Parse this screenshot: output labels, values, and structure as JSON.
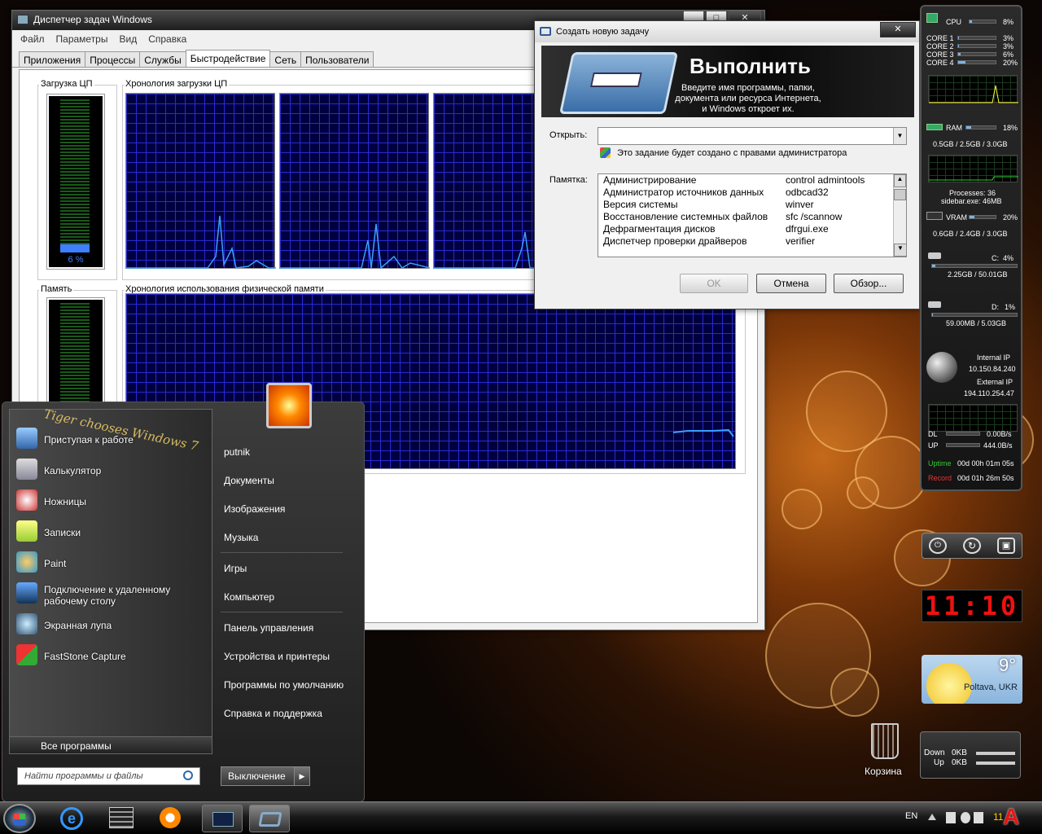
{
  "task_manager": {
    "title": "Диспетчер задач Windows",
    "menu": [
      "Файл",
      "Параметры",
      "Вид",
      "Справка"
    ],
    "tabs": [
      "Приложения",
      "Процессы",
      "Службы",
      "Быстродействие",
      "Сеть",
      "Пользователи"
    ],
    "cpu_usage_label": "Загрузка ЦП",
    "cpu_usage_value": "6 %",
    "cpu_history_label": "Хронология загрузки ЦП",
    "memory_label": "Память",
    "memory_history_label": "Хронология использования физической памяти"
  },
  "run_dialog": {
    "title": "Создать новую задачу",
    "heading": "Выполнить",
    "description": "Введите имя программы, папки, документа или ресурса Интернета, и Windows откроет их.",
    "open_label": "Открыть:",
    "open_value": "",
    "admin_note": "Это задание будет создано с правами администратора",
    "memo_label": "Памятка:",
    "memo_rows": [
      {
        "name": "Администрирование",
        "cmd": "control admintools"
      },
      {
        "name": "Администратор источников данных",
        "cmd": "odbcad32"
      },
      {
        "name": "Версия системы",
        "cmd": "winver"
      },
      {
        "name": "Восстановление системных файлов",
        "cmd": "sfc /scannow"
      },
      {
        "name": "Дефрагментация дисков",
        "cmd": "dfrgui.exe"
      },
      {
        "name": "Диспетчер проверки драйверов",
        "cmd": "verifier"
      }
    ],
    "ok": "OK",
    "cancel": "Отмена",
    "browse": "Обзор..."
  },
  "start_menu": {
    "watermark": "Tiger chooses Windows 7",
    "programs": [
      "Приступая к работе",
      "Калькулятор",
      "Ножницы",
      "Записки",
      "Paint",
      "Подключение к удаленному рабочему столу",
      "Экранная лупа",
      "FastStone Capture"
    ],
    "all_programs": "Все программы",
    "search_placeholder": "Найти программы и файлы",
    "places": [
      "putnik",
      "Документы",
      "Изображения",
      "Музыка",
      "Игры",
      "Компьютер",
      "Панель управления",
      "Устройства и принтеры",
      "Программы по умолчанию",
      "Справка и поддержка"
    ],
    "shutdown": "Выключение"
  },
  "sidebar": {
    "cpu": {
      "label": "CPU",
      "value": "8%",
      "level": 0.08
    },
    "cores": [
      {
        "label": "CORE 1",
        "value": "3%",
        "level": 0.03
      },
      {
        "label": "CORE 2",
        "value": "3%",
        "level": 0.03
      },
      {
        "label": "CORE 3",
        "value": "6%",
        "level": 0.06
      },
      {
        "label": "CORE 4",
        "value": "20%",
        "level": 0.2
      }
    ],
    "ram": {
      "label": "RAM",
      "value": "18%",
      "detail": "0.5GB / 2.5GB / 3.0GB",
      "level": 0.18
    },
    "processes": "Processes: 36",
    "top_process": "sidebar.exe: 46MB",
    "vram": {
      "label": "VRAM",
      "value": "20%",
      "detail": "0.6GB / 2.4GB / 3.0GB",
      "level": 0.2
    },
    "drive_c": {
      "label": "C:",
      "value": "4%",
      "detail": "2.25GB / 50.01GB",
      "level": 0.04
    },
    "drive_d": {
      "label": "D:",
      "value": "1%",
      "detail": "59.00MB / 5.03GB",
      "level": 0.01
    },
    "internal_ip_label": "Internal IP",
    "internal_ip": "10.150.84.240",
    "external_ip_label": "External IP",
    "external_ip": "194.110.254.47",
    "dl": {
      "label": "DL",
      "value": "0.00B/s"
    },
    "up": {
      "label": "UP",
      "value": "444.0B/s"
    },
    "uptime": {
      "label": "Uptime",
      "value": "00d 00h 01m 05s"
    },
    "record": {
      "label": "Record",
      "value": "00d 01h 26m 50s"
    }
  },
  "clock": "11:10",
  "weather": {
    "temp": "9°",
    "city": "Poltava, UKR"
  },
  "recycle_bin": "Корзина",
  "net_gadget": {
    "down_label": "Down",
    "down": "0KB",
    "up_label": "Up",
    "up": "0KB"
  },
  "taskbar": {
    "lang": "EN",
    "time": "11"
  },
  "colors": {
    "graph_bg": "#000040",
    "graph_grid": "#2a2ad0",
    "trace": "#3aa0ff",
    "accent": "#7fb3e0"
  }
}
